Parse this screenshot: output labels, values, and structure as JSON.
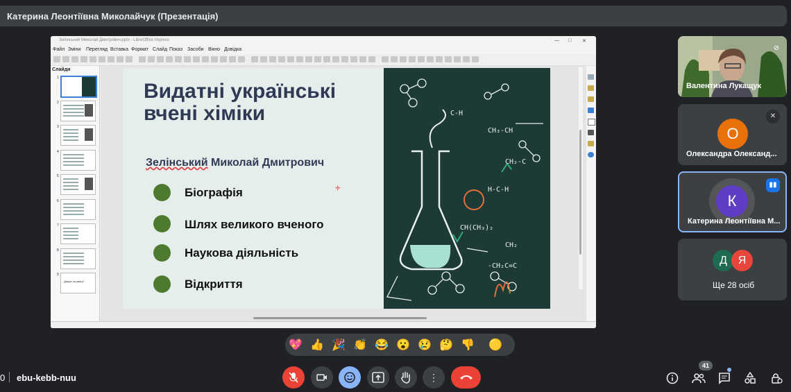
{
  "header": {
    "title": "Катерина Леонтіївна Миколайчук (Презентація)"
  },
  "window": {
    "title": "Зелінський Миколай Дмитрович.pptx - LibreOffice Impress",
    "menu": [
      "Файл",
      "Зміни",
      "Перегляд",
      "Вставка",
      "Формат",
      "Слайд",
      "Показ",
      "Засоби",
      "Вікно",
      "Довідка"
    ],
    "slides_panel_label": "Слайди",
    "slide_numbers": [
      "1",
      "2",
      "3",
      "4",
      "5",
      "6",
      "7",
      "8",
      "9"
    ],
    "last_thumb_text": "Дякую за увагу!"
  },
  "slide": {
    "title": "Видатні українські вчені хіміки",
    "subtitle_underlined": "Зелінський",
    "subtitle_rest": " Миколай Дмитрович",
    "bullets": [
      "Біографія",
      "Шлях великого вченого",
      "Наукова діяльність",
      "Відкриття"
    ],
    "bullet_color": "#4d7a2e"
  },
  "participants": [
    {
      "name": "Валентина Лукащук",
      "type": "video"
    },
    {
      "name": "Олександра Олександ...",
      "initial": "О",
      "color": "#e8710a"
    },
    {
      "name": "Катерина Леонтіївна М...",
      "initial": "К",
      "color": "#5f3dc4",
      "speaking": true
    },
    {
      "extra_initials": [
        "Д",
        "Я"
      ],
      "extra_colors": [
        "#1e6b52",
        "#e8453c"
      ],
      "more_label": "Ще 28 осіб"
    }
  ],
  "reactions": [
    "💖",
    "👍",
    "🎉",
    "👏",
    "😂",
    "😮",
    "😢",
    "🤔",
    "👎",
    "🟡"
  ],
  "footer": {
    "meeting_code": "ebu-kebb-nuu",
    "left_fragment": "0",
    "participants_count": "41"
  },
  "colors": {
    "end_call": "#ea4335",
    "mic_off": "#ea4335",
    "active_blue": "#8ab4f8"
  }
}
